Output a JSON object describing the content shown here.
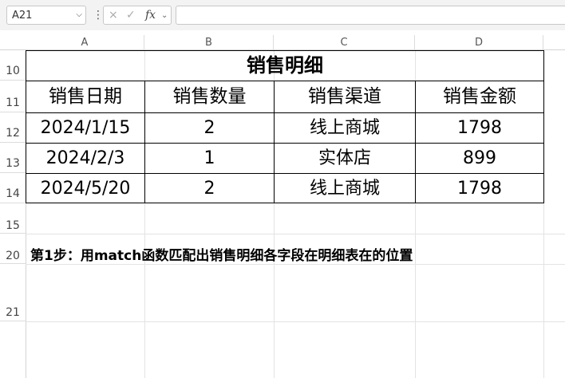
{
  "formula_bar": {
    "name_box": "A21",
    "cancel_icon": "×",
    "confirm_icon": "✓",
    "fx_label": "fx",
    "formula": ""
  },
  "columns": [
    "A",
    "B",
    "C",
    "D"
  ],
  "rows": [
    "10",
    "11",
    "12",
    "13",
    "14",
    "15",
    "20",
    "21"
  ],
  "table": {
    "title": "销售明细",
    "headers": [
      "销售日期",
      "销售数量",
      "销售渠道",
      "销售金额"
    ],
    "rows": [
      [
        "2024/1/15",
        "2",
        "线上商城",
        "1798"
      ],
      [
        "2024/2/3",
        "1",
        "实体店",
        "899"
      ],
      [
        "2024/5/20",
        "2",
        "线上商城",
        "1798"
      ]
    ]
  },
  "note": "第1步：用match函数匹配出销售明细各字段在明细表在的位置"
}
